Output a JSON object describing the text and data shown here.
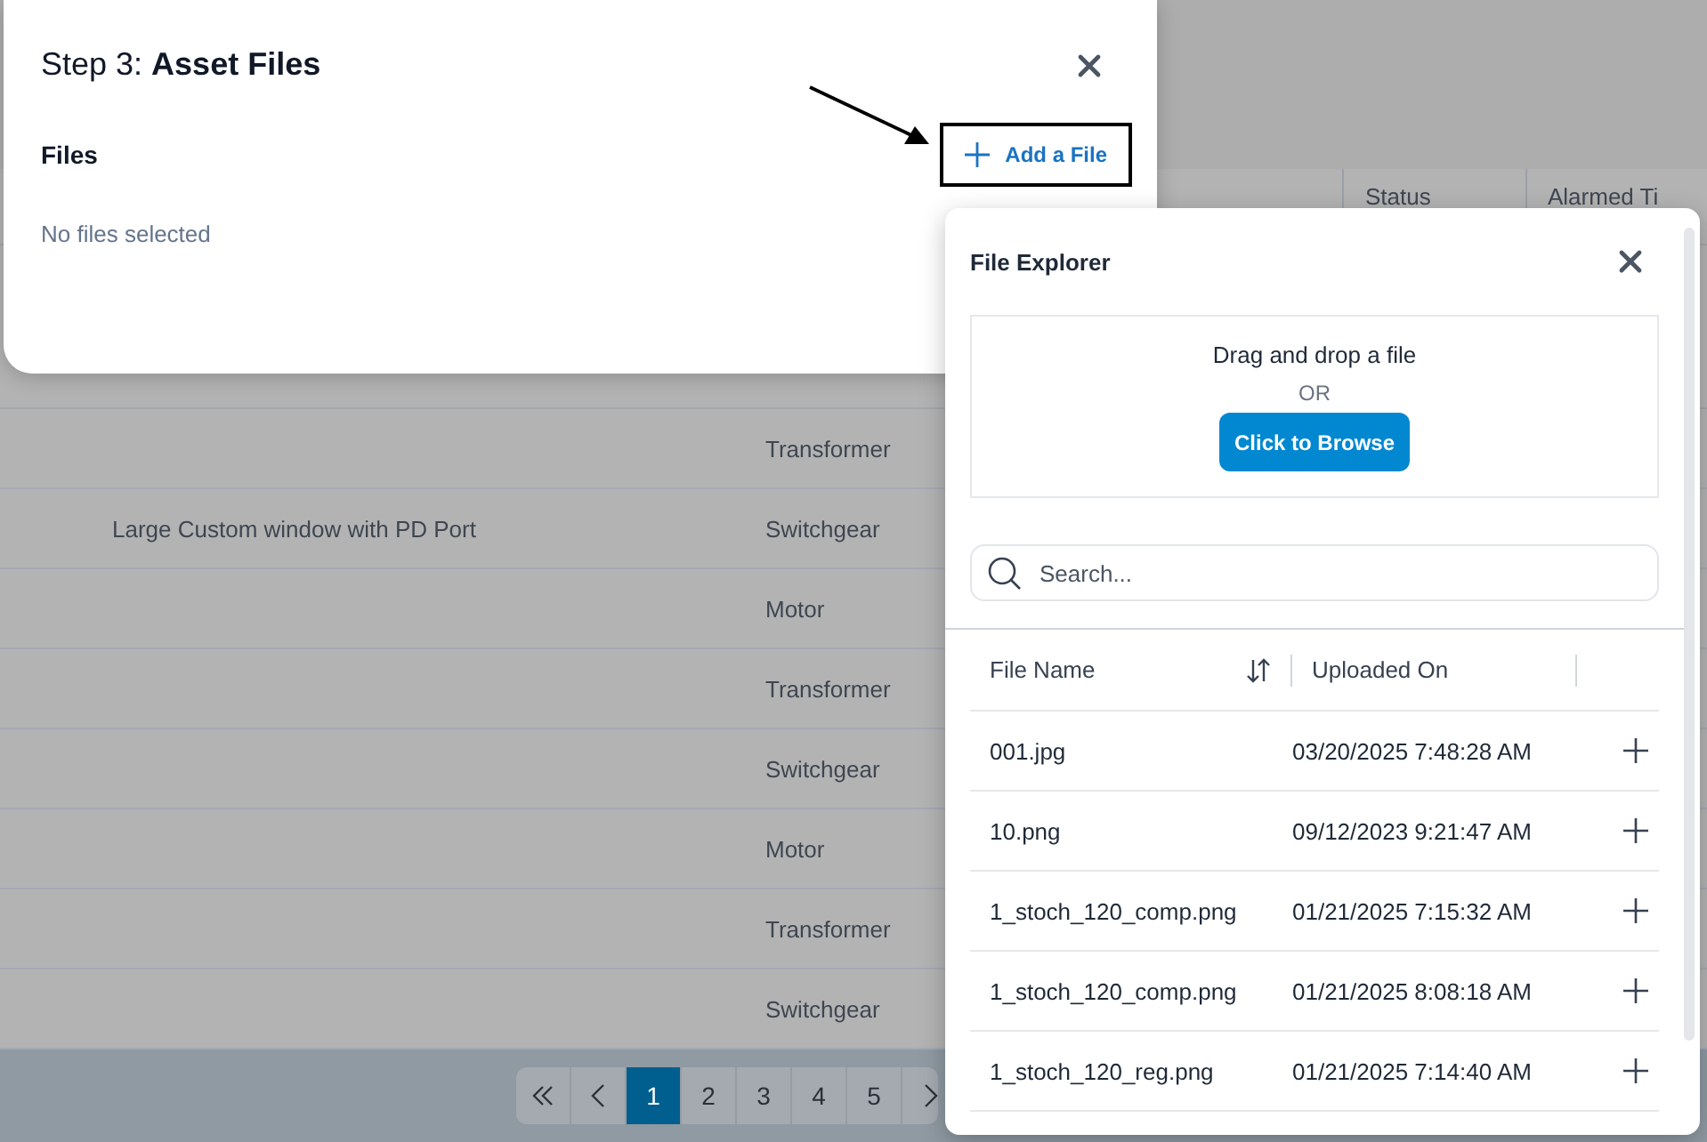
{
  "background_table": {
    "columns": [
      "Status",
      "Alarmed Ti"
    ],
    "rows": [
      {
        "type": "Transformer"
      },
      {
        "description": "Large Custom window with PD Port",
        "type": "Switchgear"
      },
      {
        "type": "Motor"
      },
      {
        "type": "Transformer"
      },
      {
        "type": "Switchgear"
      },
      {
        "type": "Motor"
      },
      {
        "type": "Transformer"
      },
      {
        "type": "Switchgear"
      }
    ]
  },
  "pagination": {
    "pages": [
      {
        "label": "1",
        "selected": true
      },
      {
        "label": "2",
        "selected": false
      },
      {
        "label": "3",
        "selected": false
      },
      {
        "label": "4",
        "selected": false
      },
      {
        "label": "5",
        "selected": false
      }
    ]
  },
  "modal": {
    "title": "Step 3: **Asset Files**",
    "section": "Files",
    "empty_text": "No files selected",
    "add_button": "Add a File"
  },
  "file_explorer": {
    "title": "File Explorer",
    "drop_text": "Drag and drop a file",
    "or_text": "OR",
    "browse_button": "Click to Browse",
    "search": {
      "placeholder": "Search..."
    },
    "columns": [
      "File Name",
      "Uploaded On"
    ],
    "files": [
      {
        "name": "001.jpg",
        "uploaded": "03/20/2025 7:48:28 AM"
      },
      {
        "name": "10.png",
        "uploaded": "09/12/2023 9:21:47 AM"
      },
      {
        "name": "1_stoch_120_comp.png",
        "uploaded": "01/21/2025 7:15:32 AM"
      },
      {
        "name": "1_stoch_120_comp.png",
        "uploaded": "01/21/2025 8:08:18 AM"
      },
      {
        "name": "1_stoch_120_reg.png",
        "uploaded": "01/21/2025 7:14:40 AM"
      }
    ]
  }
}
